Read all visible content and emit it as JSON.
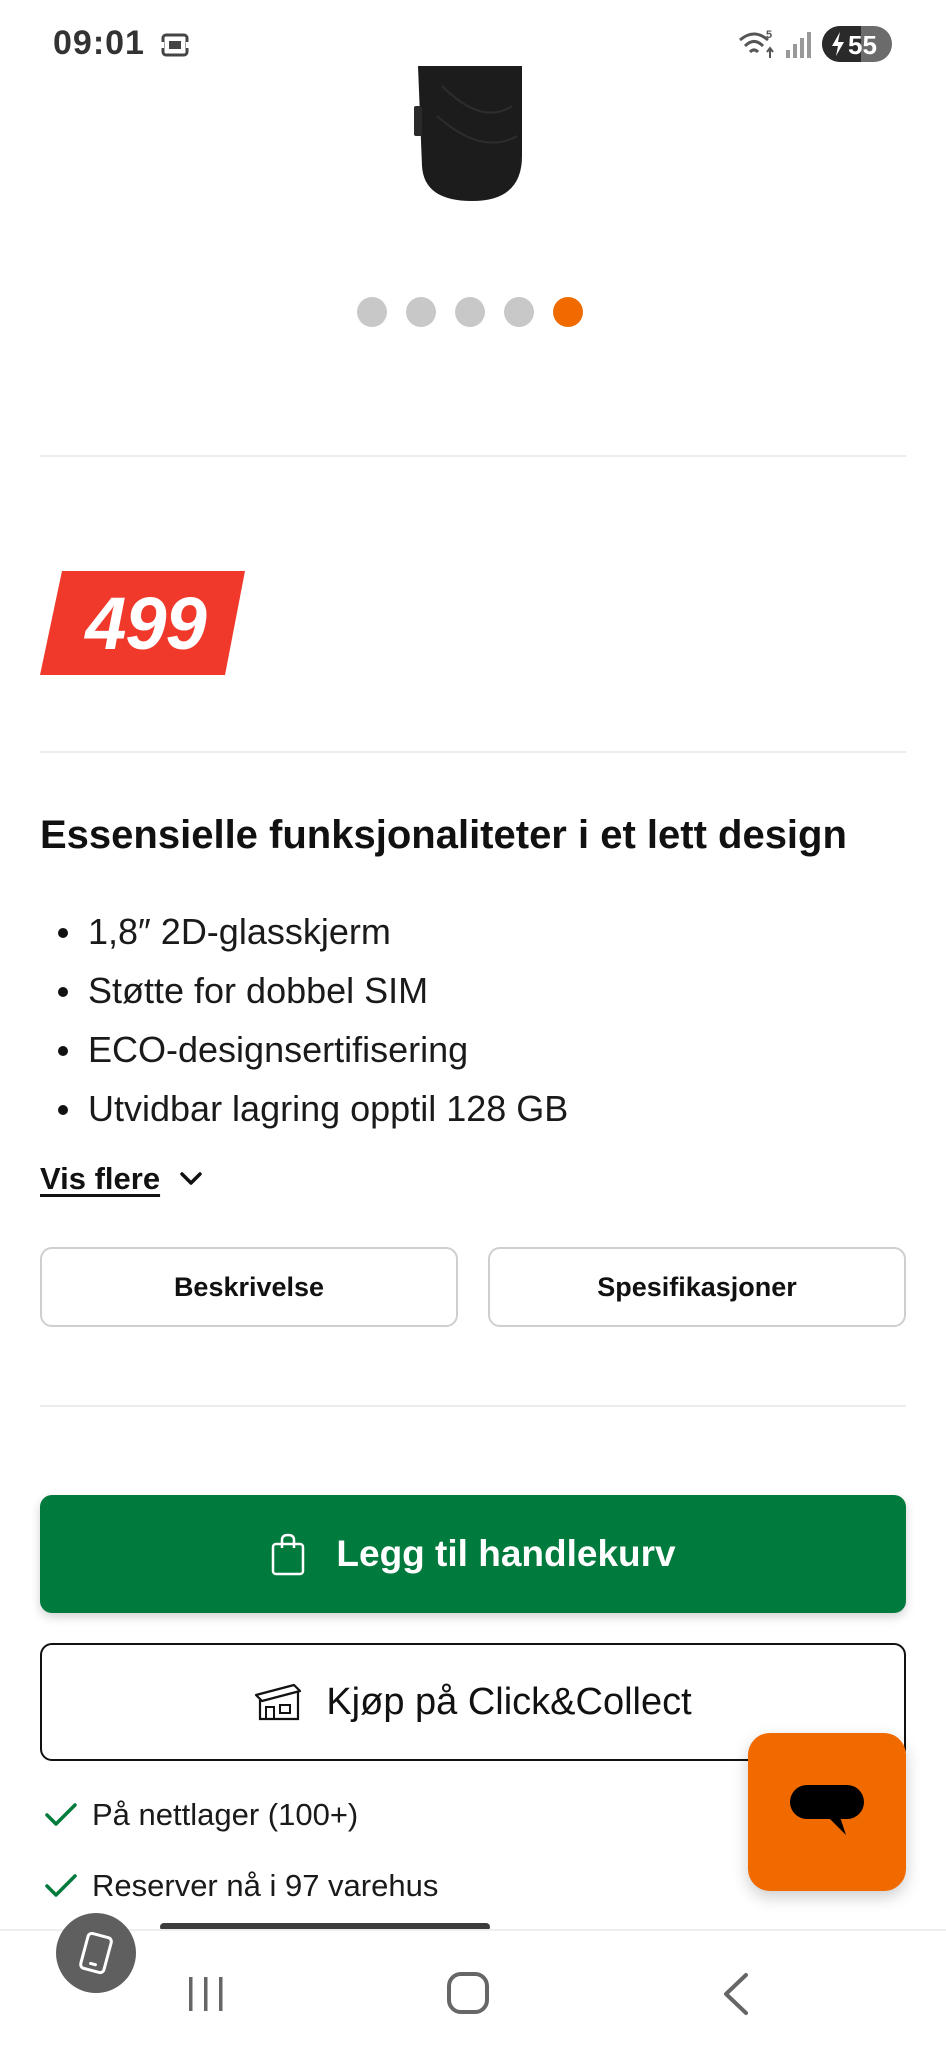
{
  "status_bar": {
    "time": "09:01",
    "battery_level": "55",
    "battery_fraction": 0.55,
    "wifi_badge": "5"
  },
  "carousel": {
    "slide_count": 5,
    "active_index": 4,
    "active_color": "#f06a00",
    "inactive_color": "#c8c8c8"
  },
  "price": {
    "value": "499",
    "badge_color": "#f0392b"
  },
  "features": {
    "title": "Essensielle funksjonaliteter i et lett design",
    "items": [
      "1,8″ 2D-glasskjerm",
      "Støtte for dobbel SIM",
      "ECO-designsertifisering",
      "Utvidbar lagring opptil 128 GB"
    ],
    "show_more_label": "Vis flere"
  },
  "tabs": {
    "description_label": "Beskrivelse",
    "specifications_label": "Spesifikasjoner"
  },
  "actions": {
    "add_to_cart_label": "Legg til handlekurv",
    "click_collect_label": "Kjøp på Click&Collect",
    "primary_color": "#007a3d"
  },
  "stock": {
    "online": "På nettlager (100+)",
    "reserve": "Reserver nå i 97 varehus"
  },
  "icons": {
    "screen": "screenshot-icon",
    "bag": "shopping-bag-icon",
    "store": "store-icon",
    "check": "check-icon",
    "chat": "chat-bubble-icon",
    "back": "back-chevron-icon"
  }
}
